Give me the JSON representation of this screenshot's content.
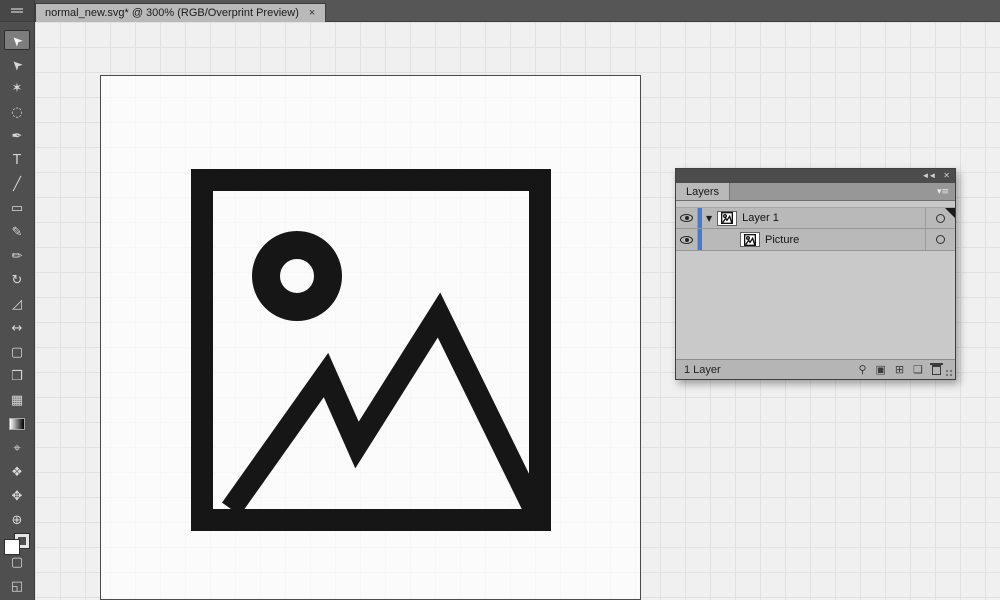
{
  "colors": {
    "selection_blue": "#4a79c9",
    "icon_black": "#141414",
    "panel_gray": "#b9b9b9"
  },
  "tab_bar": {
    "tab_title": "normal_new.svg* @ 300% (RGB/Overprint Preview)",
    "close_label": "×"
  },
  "toolbar": {
    "tools": [
      {
        "name": "selection-tool",
        "glyph": "➤",
        "rotate": true,
        "selected": true
      },
      {
        "name": "direct-selection-tool",
        "glyph": "➤",
        "rotate": true
      },
      {
        "name": "magic-wand-tool",
        "glyph": "✶"
      },
      {
        "name": "lasso-tool",
        "glyph": "◌"
      },
      {
        "name": "pen-tool",
        "glyph": "✒"
      },
      {
        "name": "type-tool",
        "glyph": "T"
      },
      {
        "name": "line-segment-tool",
        "glyph": "╱"
      },
      {
        "name": "rectangle-tool",
        "glyph": "▭"
      },
      {
        "name": "paintbrush-tool",
        "glyph": "✎"
      },
      {
        "name": "pencil-tool",
        "glyph": "✏"
      },
      {
        "name": "rotate-tool",
        "glyph": "↻"
      },
      {
        "name": "scale-tool",
        "glyph": "◿"
      },
      {
        "name": "width-tool",
        "glyph": "↔"
      },
      {
        "name": "free-transform-tool",
        "glyph": "▢"
      },
      {
        "name": "shape-builder-tool",
        "glyph": "❒"
      },
      {
        "name": "mesh-tool",
        "glyph": "▦"
      },
      {
        "name": "gradient-tool",
        "glyph": "",
        "gradient": true
      },
      {
        "name": "eyedropper-tool",
        "glyph": "⌖"
      },
      {
        "name": "blend-tool",
        "glyph": "❖"
      },
      {
        "name": "hand-tool",
        "glyph": "✥"
      },
      {
        "name": "zoom-tool",
        "glyph": "⊕"
      }
    ],
    "extra_tools": [
      {
        "name": "drawing-mode-icon",
        "glyph": "▢"
      },
      {
        "name": "screen-mode-icon",
        "glyph": "◱"
      }
    ]
  },
  "layers_panel": {
    "collapse_icon": "◄◄",
    "close_icon": "✕",
    "panel_menu_icon": "▾≡",
    "tab_label": "Layers",
    "rows": [
      {
        "label": "Layer 1",
        "disclosure": "▼"
      },
      {
        "label": "Picture"
      }
    ],
    "status_text": "1 Layer",
    "footer_buttons": [
      {
        "name": "locate-object-button",
        "glyph": "⚲"
      },
      {
        "name": "make-clip-mask-button",
        "glyph": "▣"
      },
      {
        "name": "new-sublayer-button",
        "glyph": "⊞"
      },
      {
        "name": "new-layer-button",
        "glyph": "❏"
      },
      {
        "name": "delete-layer-button",
        "glyph": "",
        "css": "trash"
      }
    ]
  }
}
